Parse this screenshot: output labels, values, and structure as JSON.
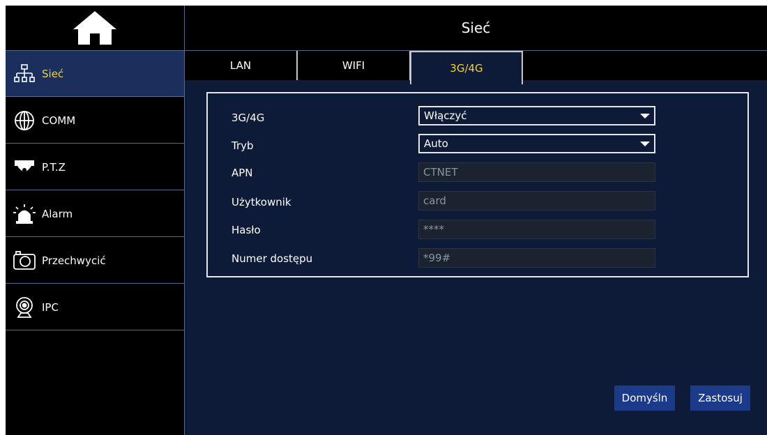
{
  "header": {
    "title": "Sieć"
  },
  "sidebar": {
    "items": [
      {
        "label": "Sieć",
        "icon": "network-icon",
        "active": true
      },
      {
        "label": "COMM",
        "icon": "globe-icon"
      },
      {
        "label": "P.T.Z",
        "icon": "ptz-camera-icon"
      },
      {
        "label": "Alarm",
        "icon": "alarm-light-icon"
      },
      {
        "label": "Przechwycić",
        "icon": "camera-icon"
      },
      {
        "label": "IPC",
        "icon": "webcam-icon"
      }
    ]
  },
  "tabs": [
    {
      "label": "LAN"
    },
    {
      "label": "WIFI"
    },
    {
      "label": "3G/4G",
      "active": true
    }
  ],
  "form": {
    "mode_label": "3G/4G",
    "mode_value": "Włączyć",
    "type_label": "Tryb",
    "type_value": "Auto",
    "apn_label": "APN",
    "apn_value": "CTNET",
    "user_label": "Użytkownik",
    "user_value": "card",
    "password_label": "Hasło",
    "password_value": "****",
    "dial_label": "Numer dostępu",
    "dial_value": "*99#"
  },
  "buttons": {
    "default_label": "Domyśln",
    "apply_label": "Zastosuj"
  },
  "colors": {
    "background": "#0d1a38",
    "accent": "#f3d23a",
    "button": "#1b3a8a"
  }
}
